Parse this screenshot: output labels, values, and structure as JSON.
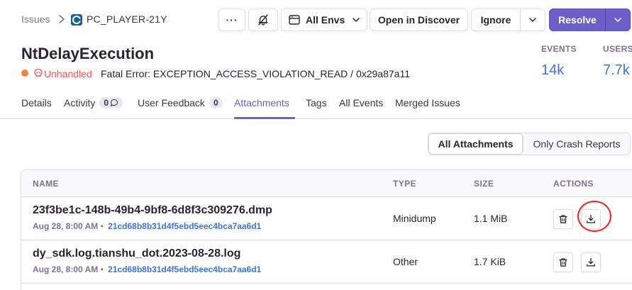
{
  "breadcrumb": {
    "root": "Issues",
    "project": "PC_PLAYER-21Y"
  },
  "toolbar": {
    "more_label": "···",
    "env_label": "All Envs",
    "discover_label": "Open in Discover",
    "ignore_label": "Ignore",
    "resolve_label": "Resolve"
  },
  "issue": {
    "title": "NtDelayExecution",
    "status": "Unhandled",
    "error": "Fatal Error: EXCEPTION_ACCESS_VIOLATION_READ / 0x29a87a11",
    "events_label": "EVENTS",
    "events_value": "14k",
    "users_label": "USERS",
    "users_value": "7.7k"
  },
  "tabs": {
    "details": "Details",
    "activity": "Activity",
    "activity_count": "0",
    "feedback": "User Feedback",
    "feedback_count": "0",
    "attachments": "Attachments",
    "tags": "Tags",
    "events": "All Events",
    "merged": "Merged Issues"
  },
  "filter": {
    "all": "All Attachments",
    "crash": "Only Crash Reports"
  },
  "table": {
    "headers": {
      "name": "NAME",
      "type": "TYPE",
      "size": "SIZE",
      "actions": "ACTIONS"
    },
    "rows": [
      {
        "name": "23f3be1c-148b-49b4-9bf8-6d8f3c309276.dmp",
        "date": "Aug 28, 8:00 AM",
        "sep": "•",
        "hash": "21cd68b8b31d4f5ebd5eec4bca7aa6d1",
        "type": "Minidump",
        "size": "1.1 MiB"
      },
      {
        "name": "dy_sdk.log.tianshu_dot.2023-08-28.log",
        "date": "Aug 28, 8:00 AM",
        "sep": "•",
        "hash": "21cd68b8b31d4f5ebd5eec4bca7aa6d1",
        "type": "Other",
        "size": "1.7 KiB"
      }
    ]
  },
  "colors": {
    "accent": "#6c5fc7",
    "link": "#3d74db",
    "unhandled": "#f55459",
    "highlight": "#e8262a"
  }
}
